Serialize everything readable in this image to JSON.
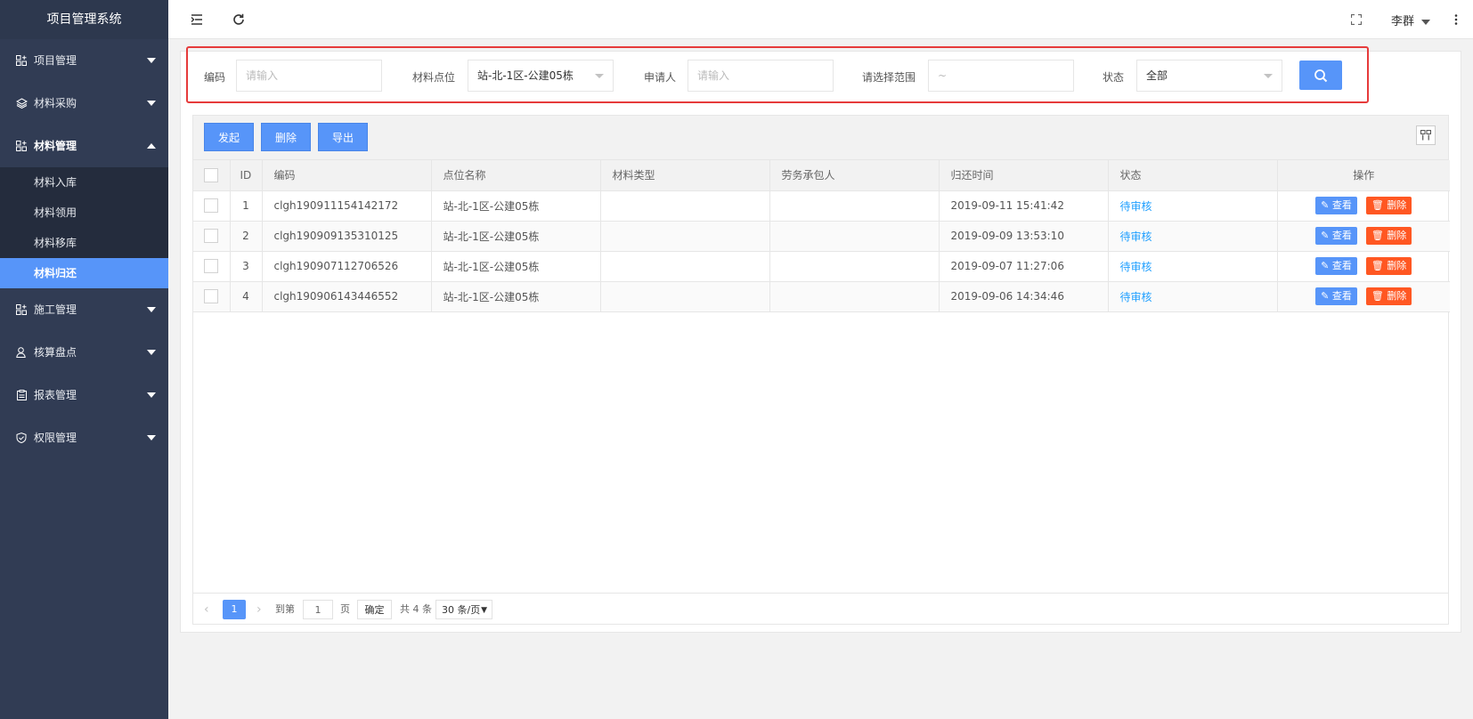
{
  "app": {
    "title": "项目管理系统"
  },
  "sidebar": {
    "items": [
      {
        "label": "项目管理",
        "icon": "grid-plus-icon"
      },
      {
        "label": "材料采购",
        "icon": "layers-icon"
      },
      {
        "label": "材料管理",
        "icon": "grid-plus-icon",
        "open": true,
        "children": [
          {
            "label": "材料入库"
          },
          {
            "label": "材料领用"
          },
          {
            "label": "材料移库"
          },
          {
            "label": "材料归还",
            "active": true
          }
        ]
      },
      {
        "label": "施工管理",
        "icon": "grid-plus-icon"
      },
      {
        "label": "核算盘点",
        "icon": "user-icon"
      },
      {
        "label": "报表管理",
        "icon": "clipboard-icon"
      },
      {
        "label": "权限管理",
        "icon": "shield-icon"
      }
    ]
  },
  "header": {
    "user": "李群"
  },
  "search": {
    "code_label": "编码",
    "code_placeholder": "请输入",
    "point_label": "材料点位",
    "point_value": "站-北-1区-公建05栋",
    "applicant_label": "申请人",
    "applicant_placeholder": "请输入",
    "range_label": "请选择范围",
    "range_placeholder": "~",
    "status_label": "状态",
    "status_value": "全部"
  },
  "toolbar": {
    "add": "发起",
    "delete": "删除",
    "export": "导出"
  },
  "table": {
    "columns": [
      "ID",
      "编码",
      "点位名称",
      "材料类型",
      "劳务承包人",
      "归还时间",
      "状态",
      "操作"
    ],
    "view_label": "查看",
    "delete_label": "删除",
    "rows": [
      {
        "id": "1",
        "code": "clgh190911154142172",
        "point": "站-北-1区-公建05栋",
        "type": "",
        "contractor": "",
        "time": "2019-09-11 15:41:42",
        "status": "待审核"
      },
      {
        "id": "2",
        "code": "clgh190909135310125",
        "point": "站-北-1区-公建05栋",
        "type": "",
        "contractor": "",
        "time": "2019-09-09 13:53:10",
        "status": "待审核"
      },
      {
        "id": "3",
        "code": "clgh190907112706526",
        "point": "站-北-1区-公建05栋",
        "type": "",
        "contractor": "",
        "time": "2019-09-07 11:27:06",
        "status": "待审核"
      },
      {
        "id": "4",
        "code": "clgh190906143446552",
        "point": "站-北-1区-公建05栋",
        "type": "",
        "contractor": "",
        "time": "2019-09-06 14:34:46",
        "status": "待审核"
      }
    ]
  },
  "pager": {
    "current": "1",
    "goto_label": "到第",
    "goto_value": "1",
    "page_unit": "页",
    "confirm": "确定",
    "total": "共 4 条",
    "page_size": "30 条/页"
  },
  "colors": {
    "primary": "#5795f9",
    "danger": "#ff5722",
    "sidebar": "#313c54",
    "highlight": "#e63b3b"
  }
}
